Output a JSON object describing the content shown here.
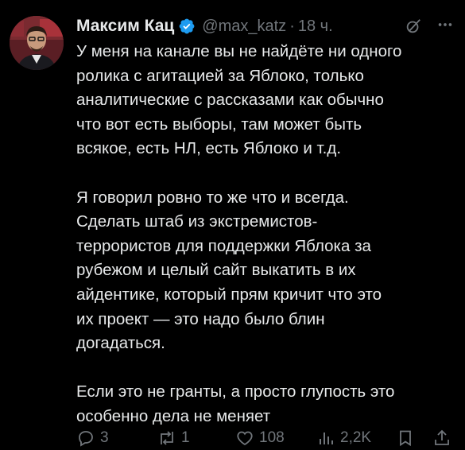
{
  "author": {
    "name": "Максим Кац",
    "handle": "@max_katz",
    "separator": "·",
    "time": "18 ч."
  },
  "colors": {
    "background": "#000000",
    "text": "#e7e9ea",
    "secondary": "#71767b",
    "verified": "#1d9bf0"
  },
  "icons": {
    "verified": "verified-badge-icon",
    "grok": "grok-icon",
    "more": "more-icon",
    "reply": "reply-icon",
    "retweet": "retweet-icon",
    "like": "like-icon",
    "views": "views-icon",
    "bookmark": "bookmark-icon",
    "share": "share-icon"
  },
  "tweet": {
    "paragraphs": [
      [
        "У меня на канале вы не найдёте ни одного",
        "ролика с агитацией за Яблоко, только",
        "аналитические с рассказами как обычно",
        "что вот есть выборы, там может быть",
        "всякое, есть НЛ, есть Яблоко и т.д."
      ],
      [
        "Я говорил ровно то же что и всегда.",
        "Сделать штаб из экстремистов-",
        "террористов для поддержки Яблока за",
        "рубежом и целый сайт выкатить в их",
        "айдентике, который прям кричит что это",
        "их проект — это надо было блин",
        "догадаться."
      ],
      [
        "Если это не гранты, а просто глупость это",
        "особенно дела не меняет"
      ]
    ]
  },
  "actions": {
    "replies": "3",
    "retweets": "1",
    "likes": "108",
    "views": "2,2K"
  }
}
